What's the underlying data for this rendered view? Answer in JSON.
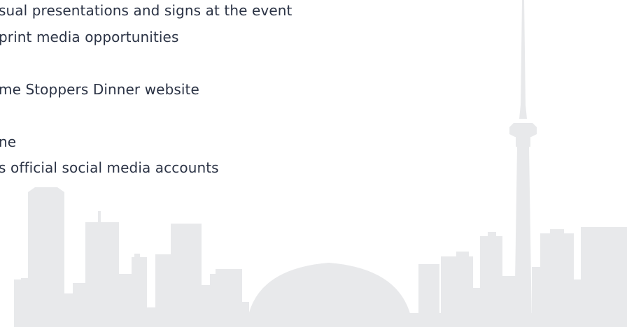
{
  "content": {
    "lines": [
      "sual presentations and signs at the event",
      "print media opportunities",
      "me Stoppers Dinner website",
      "ne",
      "s official social media accounts"
    ]
  },
  "colors": {
    "text": "#2b3345",
    "skyline": "#e8e9eb",
    "background": "#ffffff"
  }
}
